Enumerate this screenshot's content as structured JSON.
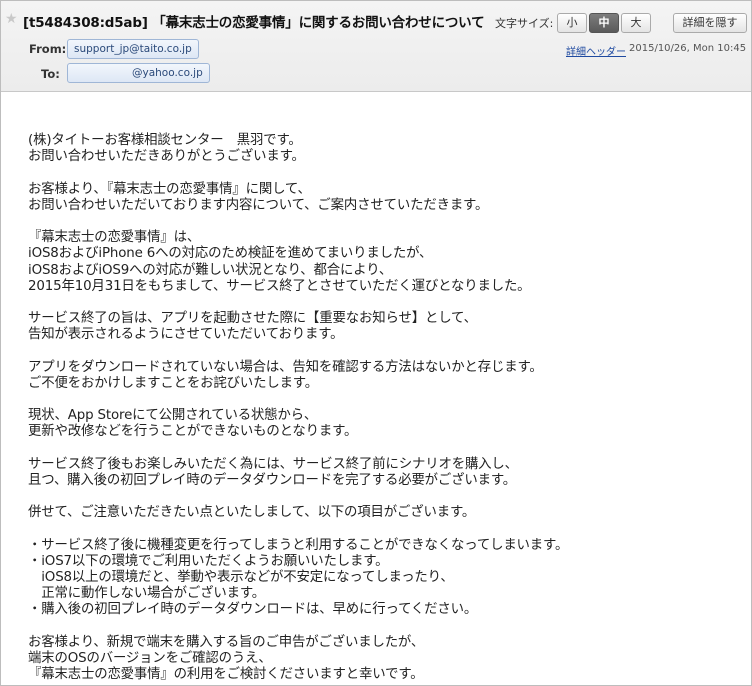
{
  "header": {
    "star_icon": "star-icon",
    "subject": "[t5484308:d5ab] 「幕末志士の恋愛事情」に関するお問い合わせについて",
    "font_size_label": "文字サイズ:",
    "font_size_options": [
      "小",
      "中",
      "大"
    ],
    "font_size_selected": "中",
    "hide_details_label": "詳細を隠す",
    "from_label": "From:",
    "from_address": "support_jp@taito.co.jp",
    "to_label": "To:",
    "to_address_visible": "@yahoo.co.jp",
    "detail_header_link": "詳細ヘッダー",
    "date": "2015/10/26, Mon 10:45"
  },
  "body": {
    "lines": [
      "(株)タイトーお客様相談センター　黒羽です。",
      "お問い合わせいただきありがとうございます。",
      "",
      "お客様より、『幕末志士の恋愛事情』に関して、",
      "お問い合わせいただいております内容について、ご案内させていただきます。",
      "",
      "『幕末志士の恋愛事情』は、",
      "iOS8およびiPhone 6への対応のため検証を進めてまいりましたが、",
      "iOS8およびiOS9への対応が難しい状況となり、都合により、",
      "2015年10月31日をもちまして、サービス終了とさせていただく運びとなりました。",
      "",
      "サービス終了の旨は、アプリを起動させた際に【重要なお知らせ】として、",
      "告知が表示されるようにさせていただいております。",
      "",
      "アプリをダウンロードされていない場合は、告知を確認する方法はないかと存じます。",
      "ご不便をおかけしますことをお詫びいたします。",
      "",
      "現状、App Storeにて公開されている状態から、",
      "更新や改修などを行うことができないものとなります。",
      "",
      "サービス終了後もお楽しみいただく為には、サービス終了前にシナリオを購入し、",
      "且つ、購入後の初回プレイ時のデータダウンロードを完了する必要がございます。",
      "",
      "併せて、ご注意いただきたい点といたしまして、以下の項目がございます。",
      "",
      "・サービス終了後に機種変更を行ってしまうと利用することができなくなってしまいます。",
      "・iOS7以下の環境でご利用いただくようお願いいたします。",
      "　iOS8以上の環境だと、挙動や表示などが不安定になってしまったり、",
      "　正常に動作しない場合がございます。",
      "・購入後の初回プレイ時のデータダウンロードは、早めに行ってください。",
      "",
      "お客様より、新規で端末を購入する旨のご申告がございましたが、",
      "端末のOSのバージョンをご確認のうえ、",
      "『幕末志士の恋愛事情』の利用をご検討くださいますと幸いです。"
    ]
  }
}
